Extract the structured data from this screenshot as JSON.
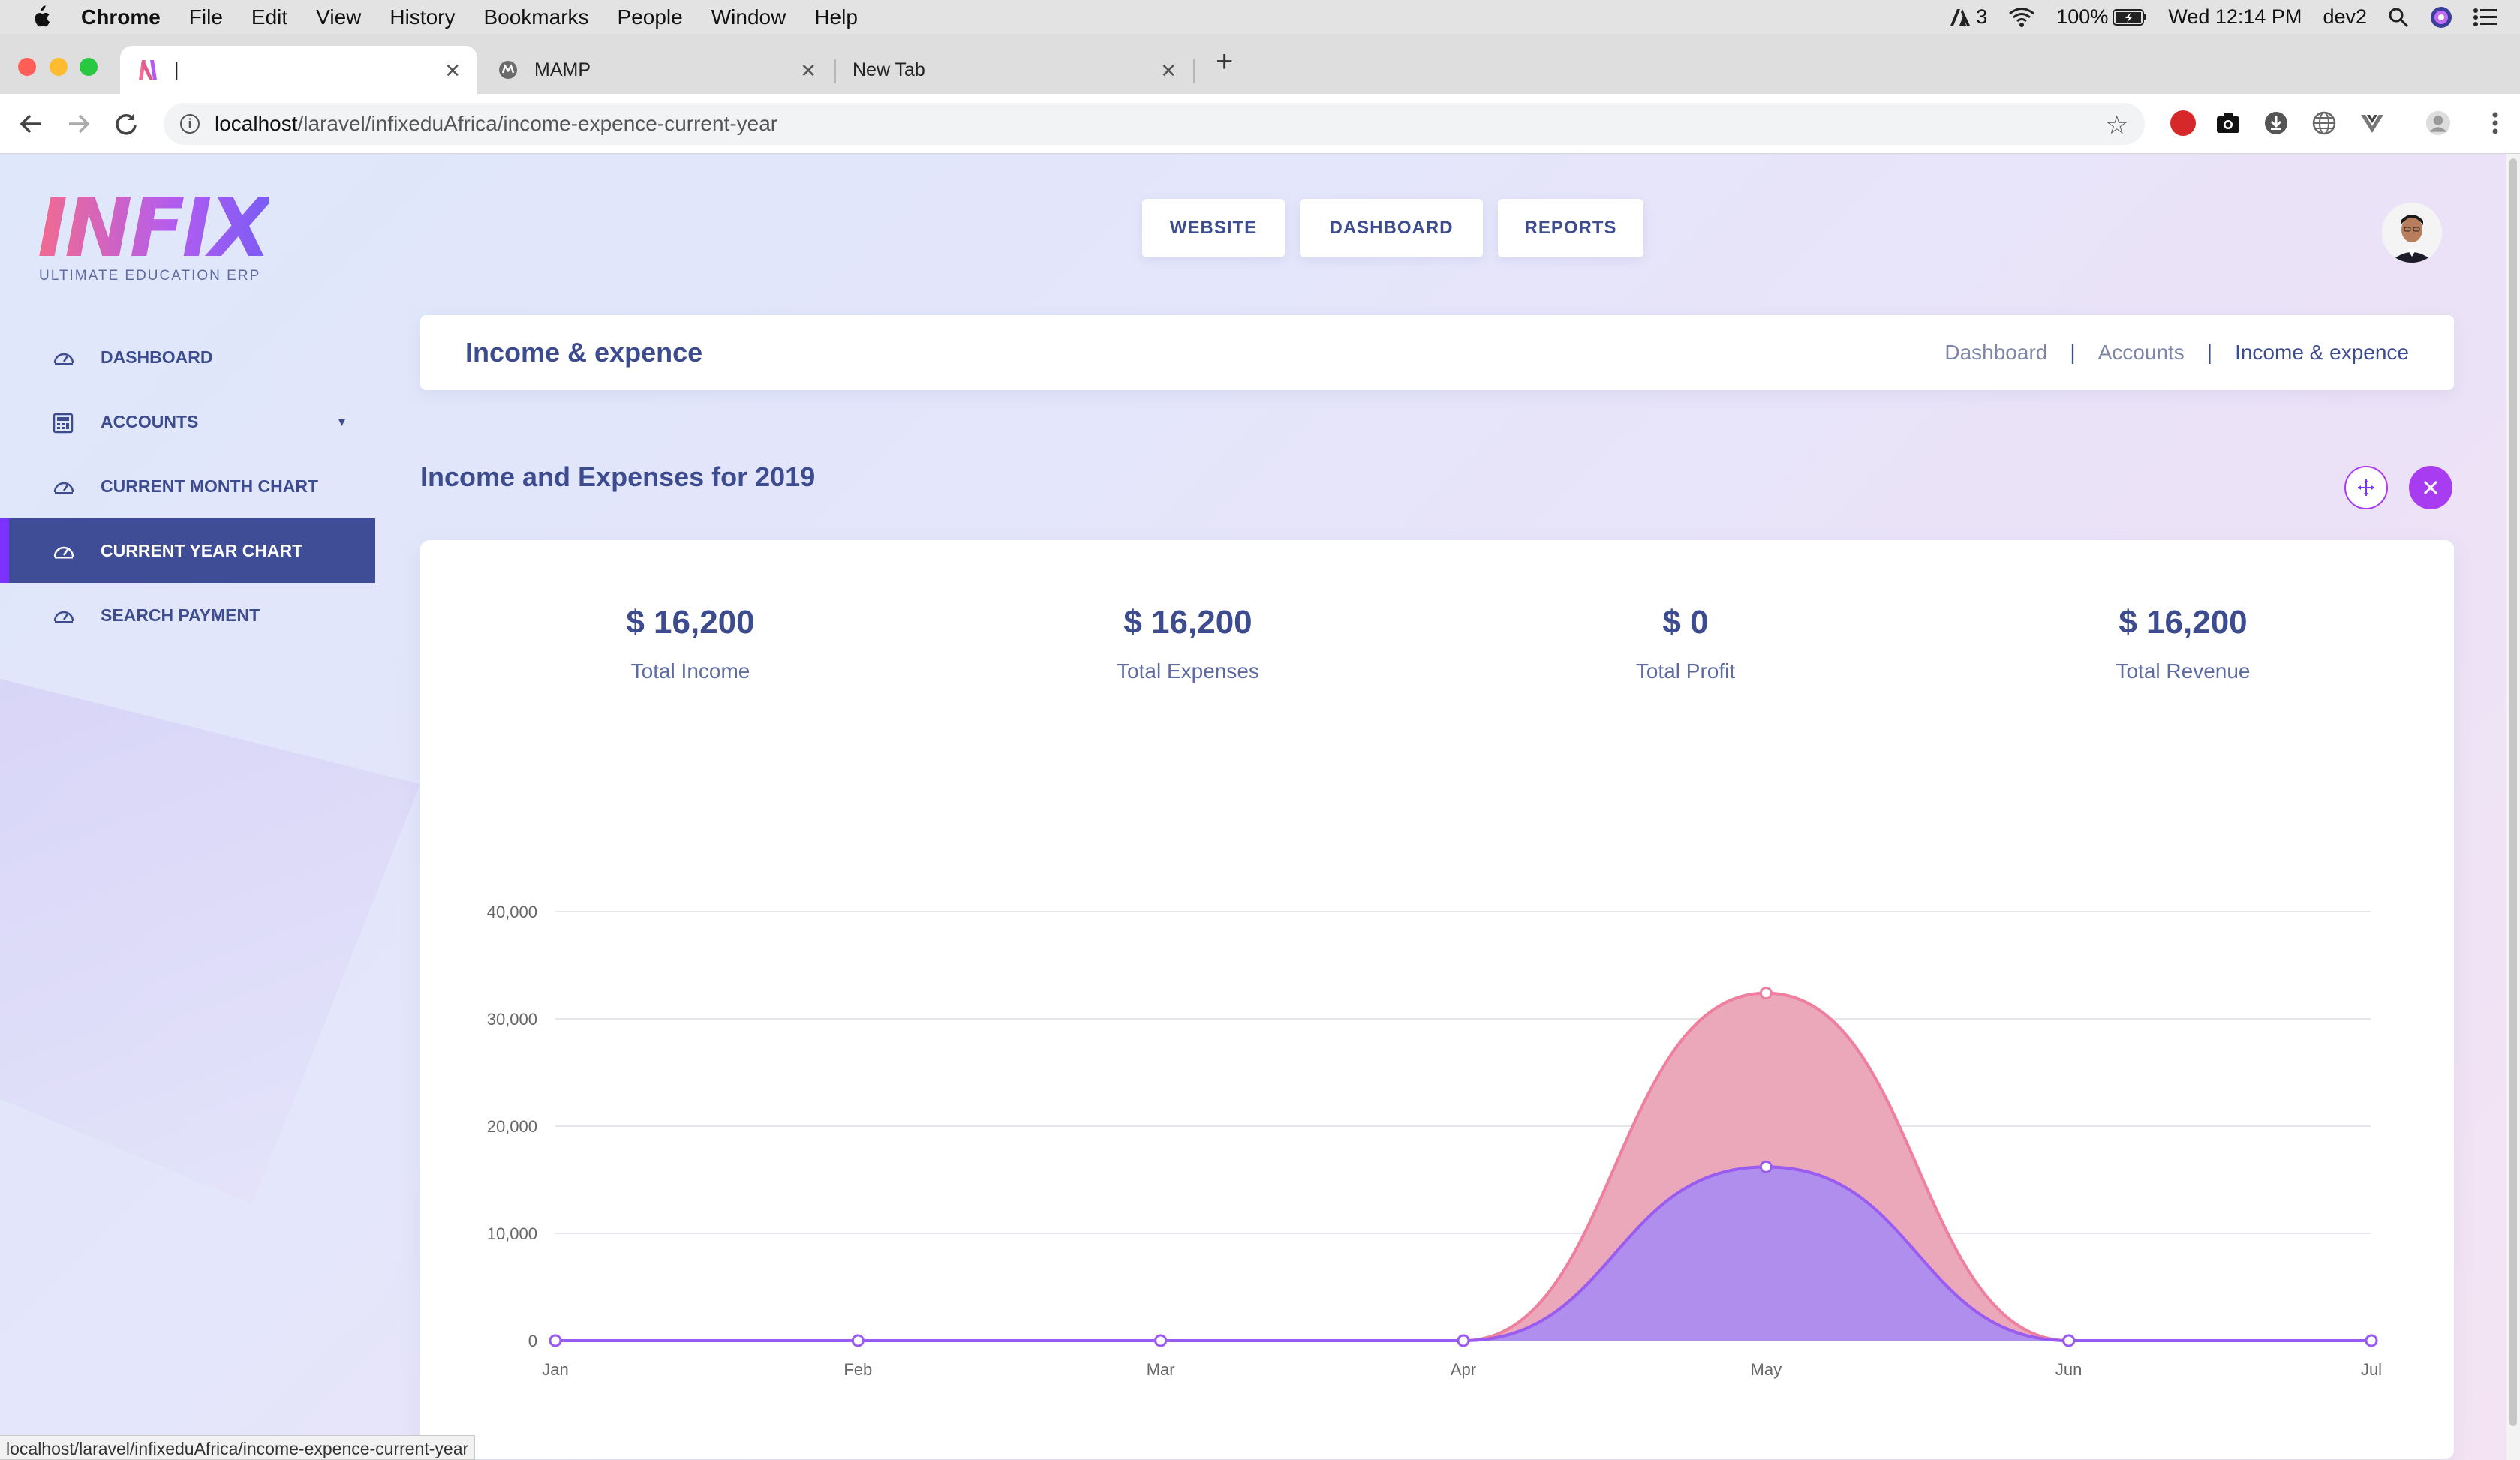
{
  "menubar": {
    "app": "Chrome",
    "items": [
      "File",
      "Edit",
      "View",
      "History",
      "Bookmarks",
      "People",
      "Window",
      "Help"
    ],
    "adobe_count": "3",
    "battery": "100%",
    "clock": "Wed 12:14 PM",
    "user": "dev2"
  },
  "tabs": [
    {
      "title": "|",
      "active": true
    },
    {
      "title": "MAMP",
      "active": false
    },
    {
      "title": "New Tab",
      "active": false
    }
  ],
  "address": {
    "host": "localhost",
    "path": "/laravel/infixeduAfrica/income-expence-current-year"
  },
  "logo": {
    "word": "INFIX",
    "tagline": "ULTIMATE EDUCATION ERP"
  },
  "sidebar": {
    "items": [
      {
        "label": "DASHBOARD",
        "icon": "speedometer-icon"
      },
      {
        "label": "ACCOUNTS",
        "icon": "calculator-icon",
        "has_caret": true
      },
      {
        "label": "CURRENT MONTH CHART",
        "icon": "speedometer-icon"
      },
      {
        "label": "CURRENT YEAR CHART",
        "icon": "speedometer-icon",
        "active": true
      },
      {
        "label": "SEARCH PAYMENT",
        "icon": "speedometer-icon"
      }
    ]
  },
  "topnav": {
    "website": "WEBSITE",
    "dashboard": "DASHBOARD",
    "reports": "REPORTS"
  },
  "breadcrumb": {
    "title": "Income & expence",
    "items": [
      "Dashboard",
      "Accounts",
      "Income & expence"
    ],
    "separator": "|"
  },
  "section": {
    "title": "Income and Expenses for 2019"
  },
  "stats": [
    {
      "value": "$ 16,200",
      "label": "Total Income"
    },
    {
      "value": "$ 16,200",
      "label": "Total Expenses"
    },
    {
      "value": "$ 0",
      "label": "Total Profit"
    },
    {
      "value": "$ 16,200",
      "label": "Total Revenue"
    }
  ],
  "colors": {
    "accent": "#7c32ff",
    "primary_text": "#3d4b8f",
    "income_fill": "#e9a3b6",
    "income_line": "#ef7f9f",
    "expense_fill": "#ad8cef",
    "expense_line": "#9a5bf0",
    "close_button": "#a83cf0"
  },
  "chart_data": {
    "type": "area",
    "categories": [
      "Jan",
      "Feb",
      "Mar",
      "Apr",
      "May",
      "Jun",
      "Jul"
    ],
    "series": [
      {
        "values": [
          0,
          0,
          0,
          0,
          32400,
          0,
          0
        ]
      },
      {
        "values": [
          0,
          0,
          0,
          0,
          16200,
          0,
          0
        ]
      }
    ],
    "stacked": true,
    "ylim": [
      0,
      40000
    ],
    "yticks": [
      "0",
      "10,000",
      "20,000",
      "30,000",
      "40,000"
    ],
    "grid": true,
    "title": "",
    "xlabel": "",
    "ylabel": ""
  },
  "status_bar": {
    "url": "localhost/laravel/infixeduAfrica/income-expence-current-year"
  }
}
